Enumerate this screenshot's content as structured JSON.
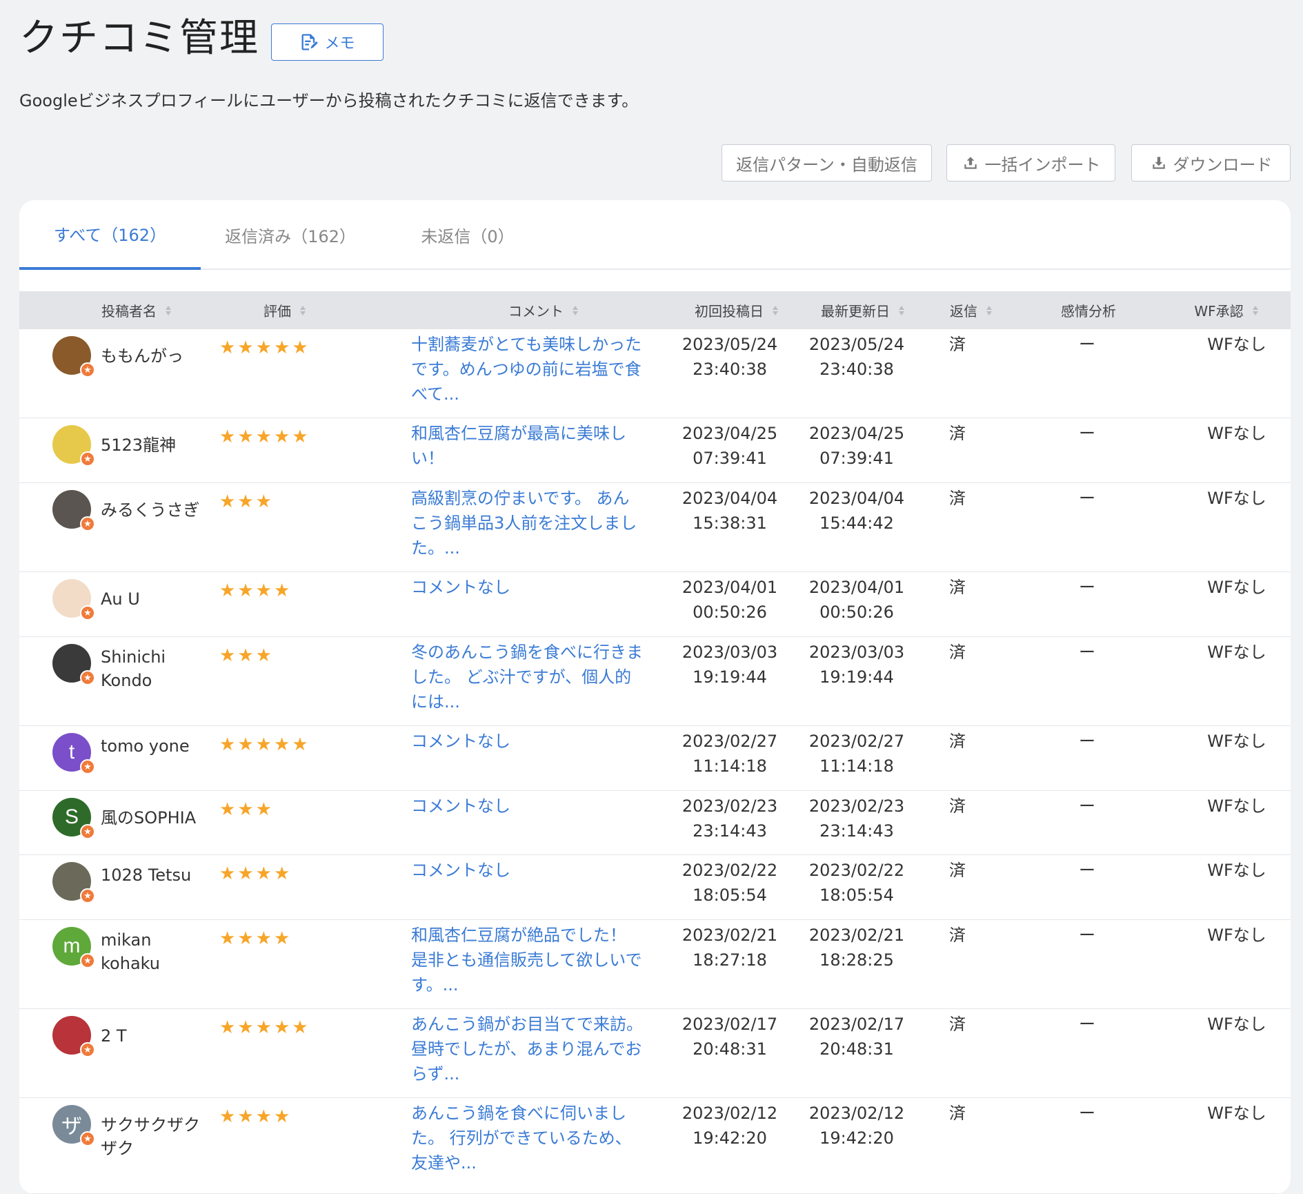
{
  "page": {
    "title": "クチコミ管理",
    "memo_label": "メモ",
    "description": "Googleビジネスプロフィールにユーザーから投稿されたクチコミに返信できます。"
  },
  "actions": {
    "reply_pattern": "返信パターン・自動返信",
    "bulk_import": "一括インポート",
    "download": "ダウンロード"
  },
  "tabs": [
    {
      "label": "すべて（162）",
      "active": true
    },
    {
      "label": "返信済み（162）",
      "active": false
    },
    {
      "label": "未返信（0）",
      "active": false
    }
  ],
  "columns": [
    "投稿者名",
    "評価",
    "コメント",
    "初回投稿日",
    "最新更新日",
    "返信",
    "感情分析",
    "WF承認"
  ],
  "rows": [
    {
      "author": "ももんがっ",
      "avatar_letter": "",
      "avatar_color": "#8a5a2b",
      "rating": 5,
      "comment": "十割蕎麦がとても美味しかったです。めんつゆの前に岩塩で食べて...",
      "first_date": "2023/05/24",
      "first_time": "23:40:38",
      "updated_date": "2023/05/24",
      "updated_time": "23:40:38",
      "reply": "済",
      "sentiment": "ー",
      "wf": "WFなし"
    },
    {
      "author": "5123龍神",
      "avatar_letter": "",
      "avatar_color": "#e6c94a",
      "rating": 5,
      "comment": "和風杏仁豆腐が最高に美味しい！",
      "first_date": "2023/04/25",
      "first_time": "07:39:41",
      "updated_date": "2023/04/25",
      "updated_time": "07:39:41",
      "reply": "済",
      "sentiment": "ー",
      "wf": "WFなし"
    },
    {
      "author": "みるくうさぎ",
      "avatar_letter": "",
      "avatar_color": "#5a5550",
      "rating": 3,
      "comment": "高級割烹の佇まいです。 あんこう鍋単品3人前を注文しました。...",
      "first_date": "2023/04/04",
      "first_time": "15:38:31",
      "updated_date": "2023/04/04",
      "updated_time": "15:44:42",
      "reply": "済",
      "sentiment": "ー",
      "wf": "WFなし"
    },
    {
      "author": "Au U",
      "avatar_letter": "",
      "avatar_color": "#f2dcc8",
      "rating": 4,
      "comment": "コメントなし",
      "first_date": "2023/04/01",
      "first_time": "00:50:26",
      "updated_date": "2023/04/01",
      "updated_time": "00:50:26",
      "reply": "済",
      "sentiment": "ー",
      "wf": "WFなし"
    },
    {
      "author": "Shinichi Kondo",
      "avatar_letter": "",
      "avatar_color": "#3a3a3a",
      "rating": 3,
      "comment": "冬のあんこう鍋を食べに行きました。 どぶ汁ですが、個人的には...",
      "first_date": "2023/03/03",
      "first_time": "19:19:44",
      "updated_date": "2023/03/03",
      "updated_time": "19:19:44",
      "reply": "済",
      "sentiment": "ー",
      "wf": "WFなし"
    },
    {
      "author": "tomo yone",
      "avatar_letter": "t",
      "avatar_color": "#7b4fc9",
      "rating": 5,
      "comment": "コメントなし",
      "first_date": "2023/02/27",
      "first_time": "11:14:18",
      "updated_date": "2023/02/27",
      "updated_time": "11:14:18",
      "reply": "済",
      "sentiment": "ー",
      "wf": "WFなし"
    },
    {
      "author": "風のSOPHIA",
      "avatar_letter": "S",
      "avatar_color": "#2e6b2a",
      "rating": 3,
      "comment": "コメントなし",
      "first_date": "2023/02/23",
      "first_time": "23:14:43",
      "updated_date": "2023/02/23",
      "updated_time": "23:14:43",
      "reply": "済",
      "sentiment": "ー",
      "wf": "WFなし"
    },
    {
      "author": "1028 Tetsu",
      "avatar_letter": "",
      "avatar_color": "#6b6a5a",
      "rating": 4,
      "comment": "コメントなし",
      "first_date": "2023/02/22",
      "first_time": "18:05:54",
      "updated_date": "2023/02/22",
      "updated_time": "18:05:54",
      "reply": "済",
      "sentiment": "ー",
      "wf": "WFなし"
    },
    {
      "author": "mikan kohaku",
      "avatar_letter": "m",
      "avatar_color": "#5fa83a",
      "rating": 4,
      "comment": "和風杏仁豆腐が絶品でした！ 是非とも通信販売して欲しいです。...",
      "first_date": "2023/02/21",
      "first_time": "18:27:18",
      "updated_date": "2023/02/21",
      "updated_time": "18:28:25",
      "reply": "済",
      "sentiment": "ー",
      "wf": "WFなし"
    },
    {
      "author": "2 T",
      "avatar_letter": "",
      "avatar_color": "#b8333a",
      "rating": 5,
      "comment": "あんこう鍋がお目当てで来訪。昼時でしたが、あまり混んでおらず...",
      "first_date": "2023/02/17",
      "first_time": "20:48:31",
      "updated_date": "2023/02/17",
      "updated_time": "20:48:31",
      "reply": "済",
      "sentiment": "ー",
      "wf": "WFなし"
    },
    {
      "author": "サクサクザクザク",
      "avatar_letter": "ザ",
      "avatar_color": "#7a8a99",
      "rating": 4,
      "comment": "あんこう鍋を食べに伺いました。 行列ができているため、友達や...",
      "first_date": "2023/02/12",
      "first_time": "19:42:20",
      "updated_date": "2023/02/12",
      "updated_time": "19:42:20",
      "reply": "済",
      "sentiment": "ー",
      "wf": "WFなし"
    }
  ]
}
